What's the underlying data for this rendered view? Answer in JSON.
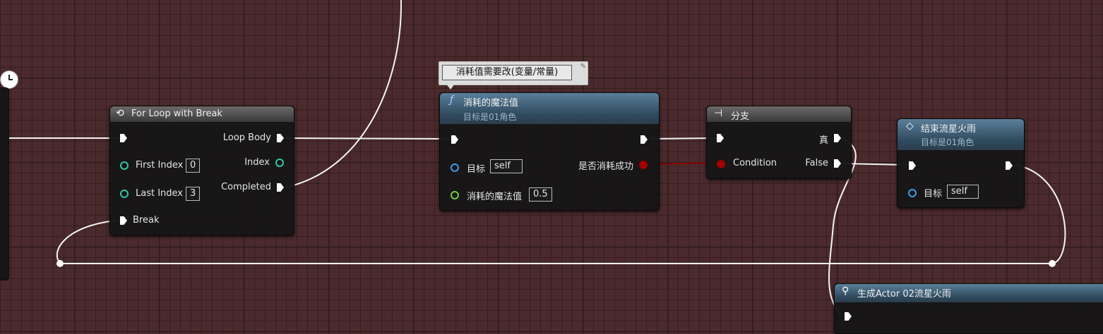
{
  "comment": {
    "text": "消耗值需要改(变量/常量)",
    "pin_icon": "pin-icon"
  },
  "for_loop": {
    "title": "For Loop with Break",
    "icon": "loop-icon",
    "inputs": {
      "first_index_label": "First Index",
      "first_index_value": "0",
      "last_index_label": "Last Index",
      "last_index_value": "3",
      "break_label": "Break"
    },
    "outputs": {
      "loop_body_label": "Loop Body",
      "index_label": "Index",
      "completed_label": "Completed"
    }
  },
  "consume_node": {
    "title": "消耗的魔法值",
    "subtitle": "目标是01角色",
    "icon": "function-icon",
    "target_label": "目标",
    "target_value": "self",
    "amount_label": "消耗的魔法值",
    "amount_value": "0.5",
    "success_label": "是否消耗成功"
  },
  "branch_node": {
    "title": "分支",
    "icon": "branch-icon",
    "condition_label": "Condition",
    "true_label": "真",
    "false_label": "False"
  },
  "end_node": {
    "title": "结束流星火雨",
    "subtitle": "目标是01角色",
    "icon": "event-diamond-icon",
    "target_label": "目标",
    "target_value": "self"
  },
  "spawn_node": {
    "title": "生成Actor 02流星火雨",
    "icon": "spawn-actor-icon"
  },
  "colors": {
    "exec": "#ffffff",
    "integer_pin": "#2fc7a8",
    "object_pin": "#3aa0e8",
    "float_pin": "#6fd13a",
    "bool_pin": "#a00000",
    "function_header": "#2f4a5e",
    "macro_header": "#3a3a3a"
  }
}
